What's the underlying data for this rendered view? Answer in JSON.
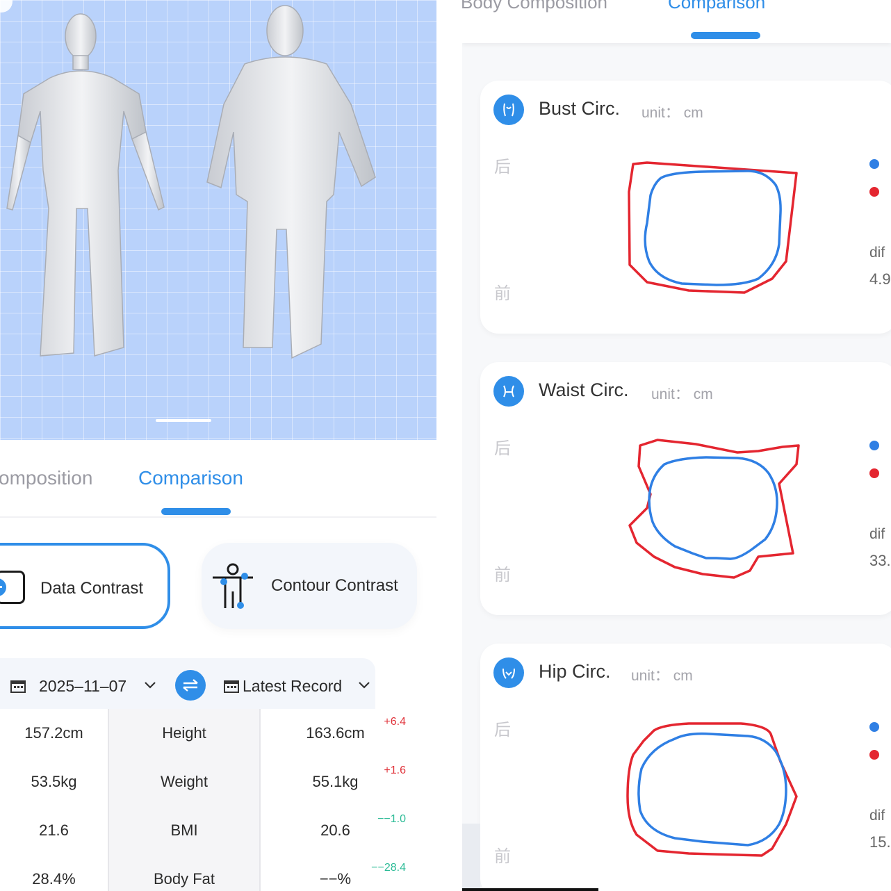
{
  "left_panel": {
    "tabs": [
      {
        "label": "omposition",
        "active": false
      },
      {
        "label": "Comparison",
        "active": true
      }
    ],
    "contrast_modes": [
      {
        "label": "Data Contrast",
        "selected": true,
        "icon": "data-contrast-icon"
      },
      {
        "label": "Contour Contrast",
        "selected": false,
        "icon": "body-contour-icon"
      }
    ],
    "date_selector": {
      "left_date": "2025–11–07",
      "right_record": "Latest Record",
      "calendar_icon": "calendar-icon",
      "swap_icon": "swap-icon"
    },
    "table_rows": [
      {
        "left": "157.2cm",
        "metric": "Height",
        "right": "163.6cm",
        "diff": "+6.4",
        "diff_sign": "positive"
      },
      {
        "left": "53.5kg",
        "metric": "Weight",
        "right": "55.1kg",
        "diff": "+1.6",
        "diff_sign": "positive"
      },
      {
        "left": "21.6",
        "metric": "BMI",
        "right": "20.6",
        "diff": "−−1.0",
        "diff_sign": "negative"
      },
      {
        "left": "28.4%",
        "metric": "Body Fat",
        "right": "−−%",
        "diff": "−−28.4",
        "diff_sign": "negative"
      }
    ]
  },
  "right_panel": {
    "tabs": [
      {
        "label": "Body Composition",
        "active": false
      },
      {
        "label": "Comparison",
        "active": true
      }
    ],
    "cards": [
      {
        "title": "Bust Circ.",
        "unit": "unit： cm",
        "back_label": "后",
        "front_label": "前",
        "diff_label": "dif",
        "diff_value": "4.9",
        "icon": "bust-icon"
      },
      {
        "title": "Waist Circ.",
        "unit": "unit： cm",
        "back_label": "后",
        "front_label": "前",
        "diff_label": "dif",
        "diff_value": "33.",
        "icon": "waist-icon"
      },
      {
        "title": "Hip Circ.",
        "unit": "unit： cm",
        "back_label": "后",
        "front_label": "前",
        "diff_label": "dif",
        "diff_value": "15.",
        "icon": "hip-icon"
      }
    ]
  },
  "colors": {
    "accent": "#2f8ee8",
    "red_contour": "#e42630",
    "blue_contour": "#2f7fe4",
    "increase": "#e0323a",
    "decrease": "#2bbb96",
    "viewport_bg": "#b9d2fb"
  }
}
